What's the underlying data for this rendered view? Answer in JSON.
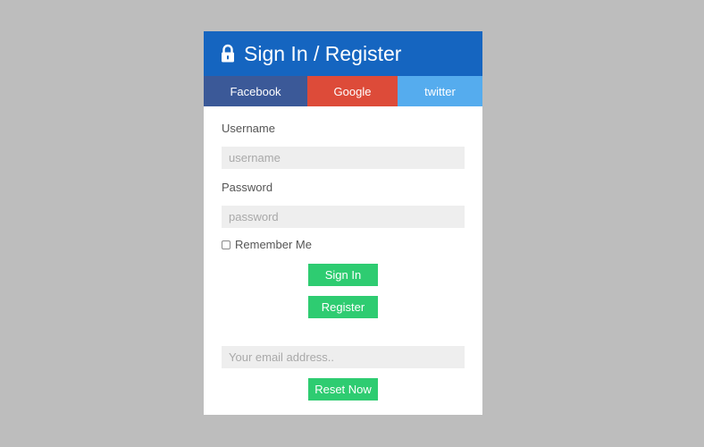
{
  "header": {
    "icon": "lock-icon",
    "title": "Sign In / Register"
  },
  "social": {
    "facebook": "Facebook",
    "google": "Google",
    "twitter": "twitter"
  },
  "form": {
    "username_label": "Username",
    "username_placeholder": "username",
    "username_value": "",
    "password_label": "Password",
    "password_placeholder": "password",
    "password_value": "",
    "remember_label": "Remember Me",
    "remember_checked": false,
    "signin_label": "Sign In",
    "register_label": "Register"
  },
  "reset": {
    "email_placeholder": "Your email address..",
    "email_value": "",
    "reset_label": "Reset Now"
  },
  "colors": {
    "background": "#bdbdbd",
    "header": "#1565c0",
    "facebook": "#3b5998",
    "google": "#dd4b39",
    "twitter": "#55acee",
    "action_green": "#2ecc71",
    "input_bg": "#eeeeee"
  }
}
